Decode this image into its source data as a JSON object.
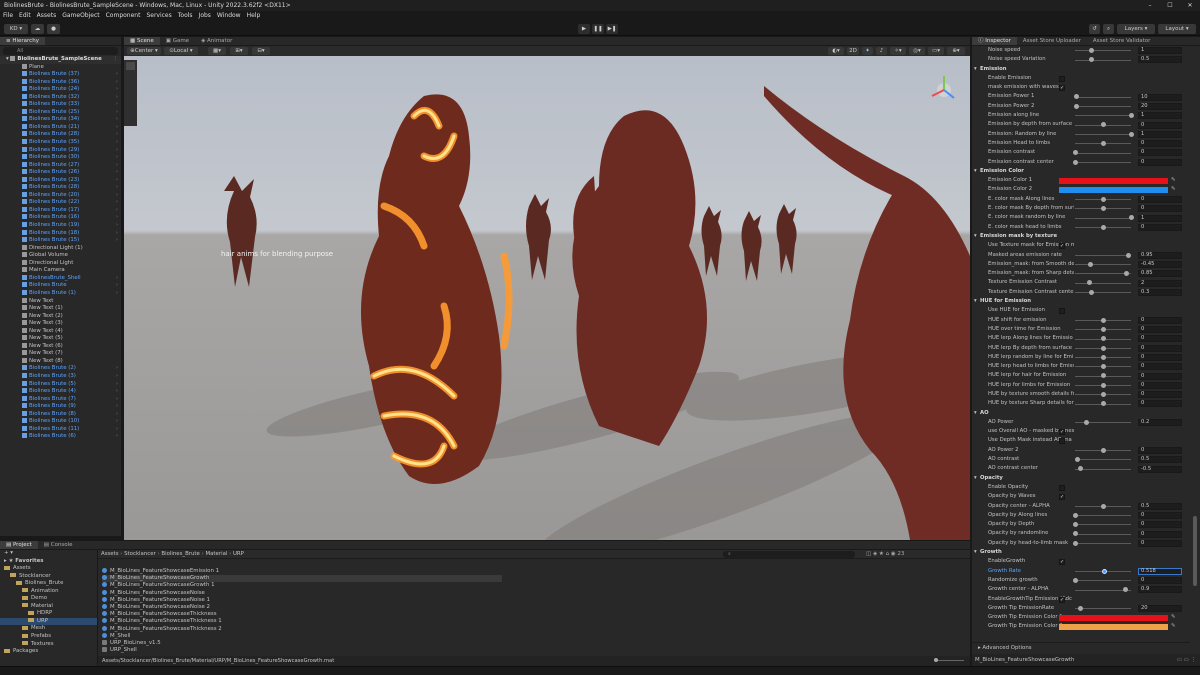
{
  "window": {
    "title": "BiolinesBrute - BiolinesBrute_SampleScene - Windows, Mac, Linux - Unity 2022.3.62f2 <DX11>"
  },
  "menu": [
    "File",
    "Edit",
    "Assets",
    "GameObject",
    "Component",
    "Services",
    "Tools",
    "Jobs",
    "Window",
    "Help"
  ],
  "toolbar": {
    "account": "KD",
    "layers": "Layers",
    "layout": "Layout"
  },
  "hierarchy": {
    "tab": "Hierarchy",
    "search": "All",
    "scene": "BiolinesBrute_SampleScene",
    "items": [
      {
        "label": "Plane",
        "blue": false
      },
      {
        "label": "Biolines Brute (37)",
        "blue": true
      },
      {
        "label": "Biolines Brute (36)",
        "blue": true
      },
      {
        "label": "Biolines Brute (24)",
        "blue": true
      },
      {
        "label": "Biolines Brute (32)",
        "blue": true
      },
      {
        "label": "Biolines Brute (33)",
        "blue": true
      },
      {
        "label": "Biolines Brute (25)",
        "blue": true
      },
      {
        "label": "Biolines Brute (34)",
        "blue": true
      },
      {
        "label": "Biolines Brute (21)",
        "blue": true
      },
      {
        "label": "Biolines Brute (28)",
        "blue": true
      },
      {
        "label": "Biolines Brute (35)",
        "blue": true
      },
      {
        "label": "Biolines Brute (29)",
        "blue": true
      },
      {
        "label": "Biolines Brute (30)",
        "blue": true
      },
      {
        "label": "Biolines Brute (27)",
        "blue": true
      },
      {
        "label": "Biolines Brute (26)",
        "blue": true
      },
      {
        "label": "Biolines Brute (23)",
        "blue": true
      },
      {
        "label": "Biolines Brute (28)",
        "blue": true
      },
      {
        "label": "Biolines Brute (20)",
        "blue": true
      },
      {
        "label": "Biolines Brute (22)",
        "blue": true
      },
      {
        "label": "Biolines Brute (17)",
        "blue": true
      },
      {
        "label": "Biolines Brute (16)",
        "blue": true
      },
      {
        "label": "Biolines Brute (19)",
        "blue": true
      },
      {
        "label": "Biolines Brute (18)",
        "blue": true
      },
      {
        "label": "Biolines Brute (15)",
        "blue": true
      },
      {
        "label": "Directional Light (1)",
        "blue": false
      },
      {
        "label": "Global Volume",
        "blue": false
      },
      {
        "label": "Directional Light",
        "blue": false
      },
      {
        "label": "Main Camera",
        "blue": false
      },
      {
        "label": "BiolinesBrute_Shell",
        "blue": true
      },
      {
        "label": "Biolines Brute",
        "blue": true
      },
      {
        "label": "Biolines Brute (1)",
        "blue": true
      },
      {
        "label": "New Text",
        "blue": false
      },
      {
        "label": "New Text (1)",
        "blue": false
      },
      {
        "label": "New Text (2)",
        "blue": false
      },
      {
        "label": "New Text (3)",
        "blue": false
      },
      {
        "label": "New Text (4)",
        "blue": false
      },
      {
        "label": "New Text (5)",
        "blue": false
      },
      {
        "label": "New Text (6)",
        "blue": false
      },
      {
        "label": "New Text (7)",
        "blue": false
      },
      {
        "label": "New Text (8)",
        "blue": false
      },
      {
        "label": "Biolines Brute (2)",
        "blue": true
      },
      {
        "label": "Biolines Brute (3)",
        "blue": true
      },
      {
        "label": "Biolines Brute (5)",
        "blue": true
      },
      {
        "label": "Biolines Brute (4)",
        "blue": true
      },
      {
        "label": "Biolines Brute (7)",
        "blue": true
      },
      {
        "label": "Biolines Brute (9)",
        "blue": true
      },
      {
        "label": "Biolines Brute (8)",
        "blue": true
      },
      {
        "label": "Biolines Brute (10)",
        "blue": true
      },
      {
        "label": "Biolines Brute (11)",
        "blue": true
      },
      {
        "label": "Biolines Brute (6)",
        "blue": true
      }
    ]
  },
  "scene": {
    "tabs": [
      "Scene",
      "Game",
      "Animator"
    ],
    "pivot": "Center",
    "space": "Local",
    "mode2d": "2D",
    "overlay_text": "hair anims for blending purpose"
  },
  "project": {
    "tabs": [
      "Project",
      "Console"
    ],
    "breadcrumb": [
      "Assets",
      "Stocklancer",
      "Biolines_Brute",
      "Material",
      "URP"
    ],
    "search_count": "23",
    "favorites": "Favorites",
    "tree": [
      {
        "label": "Assets",
        "depth": 0
      },
      {
        "label": "Stocklancer",
        "depth": 1
      },
      {
        "label": "Biolines_Brute",
        "depth": 2
      },
      {
        "label": "Animation",
        "depth": 3
      },
      {
        "label": "Demo",
        "depth": 3
      },
      {
        "label": "Material",
        "depth": 3
      },
      {
        "label": "HDRP",
        "depth": 4
      },
      {
        "label": "URP",
        "depth": 4
      },
      {
        "label": "Mesh",
        "depth": 3
      },
      {
        "label": "Prefabs",
        "depth": 3
      },
      {
        "label": "Textures",
        "depth": 3
      },
      {
        "label": "Packages",
        "depth": 0
      }
    ],
    "files": [
      "M_BioLines_FeatureShowcaseEmission 1",
      "M_BioLines_FeatureShowcaseGrowth",
      "M_BioLines_FeatureShowcaseGrowth 1",
      "M_BioLines_FeatureShowcaseNoise",
      "M_BioLines_FeatureShowcaseNoise 1",
      "M_BioLines_FeatureShowcaseNoise 2",
      "M_BioLines_FeatureShowcaseThickness",
      "M_BioLines_FeatureShowcaseThickness 1",
      "M_BioLines_FeatureShowcaseThickness 2",
      "M_Shell",
      "URP_BioLines_v1.5",
      "URP_Shell"
    ],
    "selected_path": "Assets/Stocklancer/Biolines_Brute/Material/URP/M_BioLines_FeatureShowcaseGrowth.mat"
  },
  "inspector": {
    "tabs": [
      "Inspector",
      "Asset Store Uploader",
      "Asset Store Validator"
    ],
    "footer": "M_BioLines_FeatureShowcaseGrowth",
    "advanced": "Advanced Options",
    "rows": [
      {
        "t": "slider",
        "label": "Noise speed",
        "k": 0.3,
        "v": "1"
      },
      {
        "t": "slider",
        "label": "Noise speed Variation",
        "k": 0.3,
        "v": "0.5"
      },
      {
        "t": "sec",
        "label": "Emission"
      },
      {
        "t": "check",
        "label": "Enable Emission",
        "c": ""
      },
      {
        "t": "check",
        "label": "mask emission with waves",
        "c": "✓"
      },
      {
        "t": "slider",
        "label": "Emission Power 1",
        "k": 0.02,
        "v": "10"
      },
      {
        "t": "slider",
        "label": "Emission Power 2",
        "k": 0.02,
        "v": "20"
      },
      {
        "t": "slider",
        "label": "Emission along line",
        "k": 1.0,
        "v": "1"
      },
      {
        "t": "slider",
        "label": "Emission by depth from surface",
        "k": 0.5,
        "v": "0"
      },
      {
        "t": "slider",
        "label": "Emission: Random by line",
        "k": 1.0,
        "v": "1"
      },
      {
        "t": "slider",
        "label": "Emission Head to limbs",
        "k": 0.5,
        "v": "0"
      },
      {
        "t": "slider",
        "label": "Emission contrast",
        "k": 0.0,
        "v": "0"
      },
      {
        "t": "slider",
        "label": "Emission contrast center",
        "k": 0.0,
        "v": "0"
      },
      {
        "t": "sec",
        "label": "Emission Color"
      },
      {
        "t": "color",
        "label": "Emission Color 1",
        "color": "#e8111a"
      },
      {
        "t": "color",
        "label": "Emission Color 2",
        "color": "#1f8ef0"
      },
      {
        "t": "slider",
        "label": "E. color mask Along lines",
        "k": 0.5,
        "v": "0"
      },
      {
        "t": "slider",
        "label": "E. color mask By depth from surf",
        "k": 0.5,
        "v": "0"
      },
      {
        "t": "slider",
        "label": "E. color mask random by line",
        "k": 1.0,
        "v": "1"
      },
      {
        "t": "slider",
        "label": "E. color mask head to limbs",
        "k": 0.5,
        "v": "0"
      },
      {
        "t": "sec",
        "label": "Emission mask by texture"
      },
      {
        "t": "check",
        "label": "Use Texture mask for Emission m",
        "c": "✓"
      },
      {
        "t": "slider",
        "label": "Masked areas emission rate",
        "k": 0.95,
        "v": "0.95"
      },
      {
        "t": "slider",
        "label": "Emission_mask: from Smooth de",
        "k": 0.28,
        "v": "-0.45"
      },
      {
        "t": "slider",
        "label": "Emission_mask: from Sharp detai",
        "k": 0.92,
        "v": "0.85"
      },
      {
        "t": "slider",
        "label": "Texture Emission Contrast",
        "k": 0.25,
        "v": "2"
      },
      {
        "t": "slider",
        "label": "Texture Emission Contrast cente",
        "k": 0.3,
        "v": "0.3"
      },
      {
        "t": "sec",
        "label": "HUE for Emission"
      },
      {
        "t": "check",
        "label": "Use HUE for Emission",
        "c": ""
      },
      {
        "t": "slider",
        "label": "HUE shift for emission",
        "k": 0.5,
        "v": "0"
      },
      {
        "t": "slider",
        "label": "HUE over time for Emission",
        "k": 0.5,
        "v": "0"
      },
      {
        "t": "slider",
        "label": "HUE lerp Along lines for Emissio",
        "k": 0.5,
        "v": "0"
      },
      {
        "t": "slider",
        "label": "HUE lerp By depth from surface",
        "k": 0.5,
        "v": "0"
      },
      {
        "t": "slider",
        "label": "HUE lerp random by line for Emi",
        "k": 0.5,
        "v": "0"
      },
      {
        "t": "slider",
        "label": "HUE lerp head to limbs for Emiss",
        "k": 0.5,
        "v": "0"
      },
      {
        "t": "slider",
        "label": "HUE lerp for hair for Emission",
        "k": 0.5,
        "v": "0"
      },
      {
        "t": "slider",
        "label": "HUE lerp for limbs for Emission",
        "k": 0.5,
        "v": "0"
      },
      {
        "t": "slider",
        "label": "HUE by texture smooth details fo",
        "k": 0.5,
        "v": "0"
      },
      {
        "t": "slider",
        "label": "HUE by texture Sharp details for",
        "k": 0.5,
        "v": "0"
      },
      {
        "t": "sec",
        "label": "AO"
      },
      {
        "t": "slider",
        "label": "AO Power",
        "k": 0.2,
        "v": "0.2"
      },
      {
        "t": "check",
        "label": "use Overall AO - masked by mest",
        "c": "✓"
      },
      {
        "t": "check",
        "label": "Use Depth Mask instead AO ma",
        "c": ""
      },
      {
        "t": "slider",
        "label": "AO Power 2",
        "k": 0.5,
        "v": "0"
      },
      {
        "t": "slider",
        "label": "AO contrast",
        "k": 0.05,
        "v": "0.5"
      },
      {
        "t": "slider",
        "label": "AO contrast center",
        "k": 0.1,
        "v": "-0.5"
      },
      {
        "t": "sec",
        "label": "Opacity"
      },
      {
        "t": "check",
        "label": "Enable Opacity",
        "c": ""
      },
      {
        "t": "check",
        "label": "Opacity by Waves",
        "c": "✓"
      },
      {
        "t": "slider",
        "label": "Opacity center - ALPHA",
        "k": 0.5,
        "v": "0.5"
      },
      {
        "t": "slider",
        "label": "Opacity by Along lines",
        "k": 0.0,
        "v": "0"
      },
      {
        "t": "slider",
        "label": "Opacity by Depth",
        "k": 0.0,
        "v": "0"
      },
      {
        "t": "slider",
        "label": "Opacity by randomline",
        "k": 0.0,
        "v": "0"
      },
      {
        "t": "slider",
        "label": "Opacity by head-to-limb mask",
        "k": 0.0,
        "v": "0"
      },
      {
        "t": "sec",
        "label": "Growth"
      },
      {
        "t": "check",
        "label": "EnableGrowth",
        "c": "✓"
      },
      {
        "t": "slider",
        "label": "Growth Rate",
        "k": 0.518,
        "v": "0.518",
        "hl": true
      },
      {
        "t": "slider",
        "label": "Randomize growth",
        "k": 0.0,
        "v": "0"
      },
      {
        "t": "slider",
        "label": "Growth center - ALPHA",
        "k": 0.9,
        "v": "0.9"
      },
      {
        "t": "check",
        "label": "EnableGrowthTip Emission (Adc",
        "c": "✓"
      },
      {
        "t": "slider",
        "label": "Growth Tip EmissionRate",
        "k": 0.1,
        "v": "20"
      },
      {
        "t": "color",
        "label": "Growth Tip Emission Color 1",
        "color": "#e8111a"
      },
      {
        "t": "color",
        "label": "Growth Tip Emission Color 2",
        "color": "#f0a048"
      }
    ]
  }
}
